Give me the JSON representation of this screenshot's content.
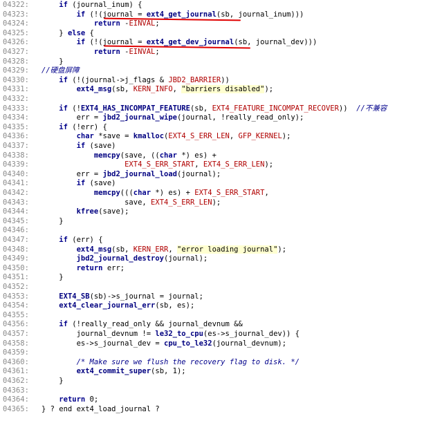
{
  "code_viewer": {
    "lines": [
      {
        "num": "04322:",
        "text": "    if (journal_inum) {"
      },
      {
        "num": "04323:",
        "text": "        if (!(journal = ext4_get_journal(sb, journal_inum)))"
      },
      {
        "num": "04324:",
        "text": "            return -EINVAL;"
      },
      {
        "num": "04325:",
        "text": "    } else {"
      },
      {
        "num": "04326:",
        "text": "        if (!(journal = ext4_get_dev_journal(sb, journal_dev)))"
      },
      {
        "num": "04327:",
        "text": "            return -EINVAL;"
      },
      {
        "num": "04328:",
        "text": "    }"
      },
      {
        "num": "04329:",
        "text": "//硬盘屏障"
      },
      {
        "num": "04330:",
        "text": "    if (!(journal->j_flags & JBD2_BARRIER))"
      },
      {
        "num": "04331:",
        "text": "        ext4_msg(sb, KERN_INFO, \"barriers disabled\");"
      },
      {
        "num": "04332:",
        "text": ""
      },
      {
        "num": "04333:",
        "text": "    if (!EXT4_HAS_INCOMPAT_FEATURE(sb, EXT4_FEATURE_INCOMPAT_RECOVER))  //不兼容"
      },
      {
        "num": "04334:",
        "text": "        err = jbd2_journal_wipe(journal, !really_read_only);"
      },
      {
        "num": "04335:",
        "text": "    if (!err) {"
      },
      {
        "num": "04336:",
        "text": "        char *save = kmalloc(EXT4_S_ERR_LEN, GFP_KERNEL);"
      },
      {
        "num": "04337:",
        "text": "        if (save)"
      },
      {
        "num": "04338:",
        "text": "            memcpy(save, ((char *) es) +"
      },
      {
        "num": "04339:",
        "text": "                   EXT4_S_ERR_START, EXT4_S_ERR_LEN);"
      },
      {
        "num": "04340:",
        "text": "        err = jbd2_journal_load(journal);"
      },
      {
        "num": "04341:",
        "text": "        if (save)"
      },
      {
        "num": "04342:",
        "text": "            memcpy(((char *) es) + EXT4_S_ERR_START,"
      },
      {
        "num": "04343:",
        "text": "                   save, EXT4_S_ERR_LEN);"
      },
      {
        "num": "04344:",
        "text": "        kfree(save);"
      },
      {
        "num": "04345:",
        "text": "    }"
      },
      {
        "num": "04346:",
        "text": ""
      },
      {
        "num": "04347:",
        "text": "    if (err) {"
      },
      {
        "num": "04348:",
        "text": "        ext4_msg(sb, KERN_ERR, \"error loading journal\");"
      },
      {
        "num": "04349:",
        "text": "        jbd2_journal_destroy(journal);"
      },
      {
        "num": "04350:",
        "text": "        return err;"
      },
      {
        "num": "04351:",
        "text": "    }"
      },
      {
        "num": "04352:",
        "text": ""
      },
      {
        "num": "04353:",
        "text": "    EXT4_SB(sb)->s_journal = journal;"
      },
      {
        "num": "04354:",
        "text": "    ext4_clear_journal_err(sb, es);"
      },
      {
        "num": "04355:",
        "text": ""
      },
      {
        "num": "04356:",
        "text": "    if (!really_read_only && journal_devnum &&"
      },
      {
        "num": "04357:",
        "text": "        journal_devnum != le32_to_cpu(es->s_journal_dev)) {"
      },
      {
        "num": "04358:",
        "text": "        es->s_journal_dev = cpu_to_le32(journal_devnum);"
      },
      {
        "num": "04359:",
        "text": ""
      },
      {
        "num": "04360:",
        "text": "        /* Make sure we flush the recovery flag to disk. */"
      },
      {
        "num": "04361:",
        "text": "        ext4_commit_super(sb, 1);"
      },
      {
        "num": "04362:",
        "text": "    }"
      },
      {
        "num": "04363:",
        "text": ""
      },
      {
        "num": "04364:",
        "text": "    return 0;"
      },
      {
        "num": "04365:",
        "text": "} ? end ext4_load_journal ?"
      }
    ]
  },
  "colors": {
    "background": "#ffffff",
    "line_number": "#8a8a8a",
    "keyword": "#00008b",
    "macro": "#b00000",
    "string_bg": "#ffffd0",
    "annotation_underline": "#e00000"
  }
}
